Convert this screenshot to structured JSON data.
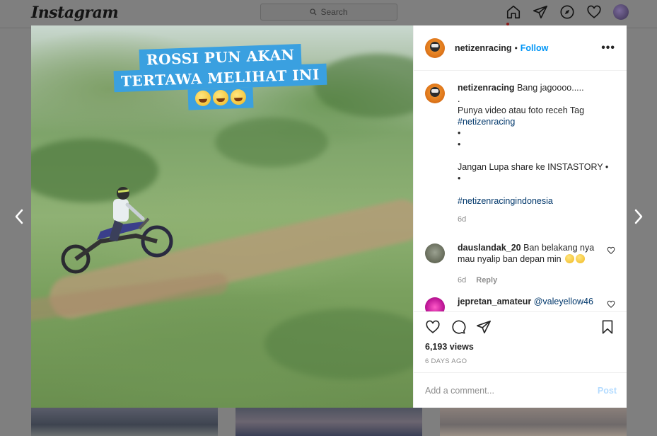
{
  "header": {
    "logo": "Instagram",
    "search_placeholder": "Search",
    "icons": [
      "home-icon",
      "direct-icon",
      "explore-icon",
      "activity-heart-icon",
      "profile-avatar"
    ]
  },
  "post": {
    "overlay_text": {
      "line1": "ROSSI PUN AKAN",
      "line2": "TERTAWA MELIHAT INI"
    },
    "author": "netizenracing",
    "dot": "•",
    "follow_label": "Follow",
    "more_label": "•••",
    "caption": {
      "username": "netizenracing",
      "lines": [
        "Bang jagoooo.....",
        ".",
        "Punya video atau foto receh Tag",
        "#netizenracing",
        "•",
        "•",
        "",
        "Jangan Lupa share ke INSTASTORY •",
        "•",
        "",
        "#netizenracingindonesia"
      ],
      "time": "6d"
    },
    "comments": [
      {
        "username": "dauslandak_20",
        "text_part1": "Ban belakang nya",
        "text_part2": "mau nyalip ban depan min",
        "time": "6d",
        "reply_label": "Reply"
      },
      {
        "username": "jepretan_amateur",
        "text": "@valeyellow46"
      }
    ],
    "views": "6,193 views",
    "posted": "6 DAYS AGO",
    "add_comment_placeholder": "Add a comment...",
    "post_label": "Post"
  },
  "colors": {
    "accent": "#0095f6",
    "caption_banner": "#3aa0e0",
    "backdrop": "#7f7f7f"
  }
}
